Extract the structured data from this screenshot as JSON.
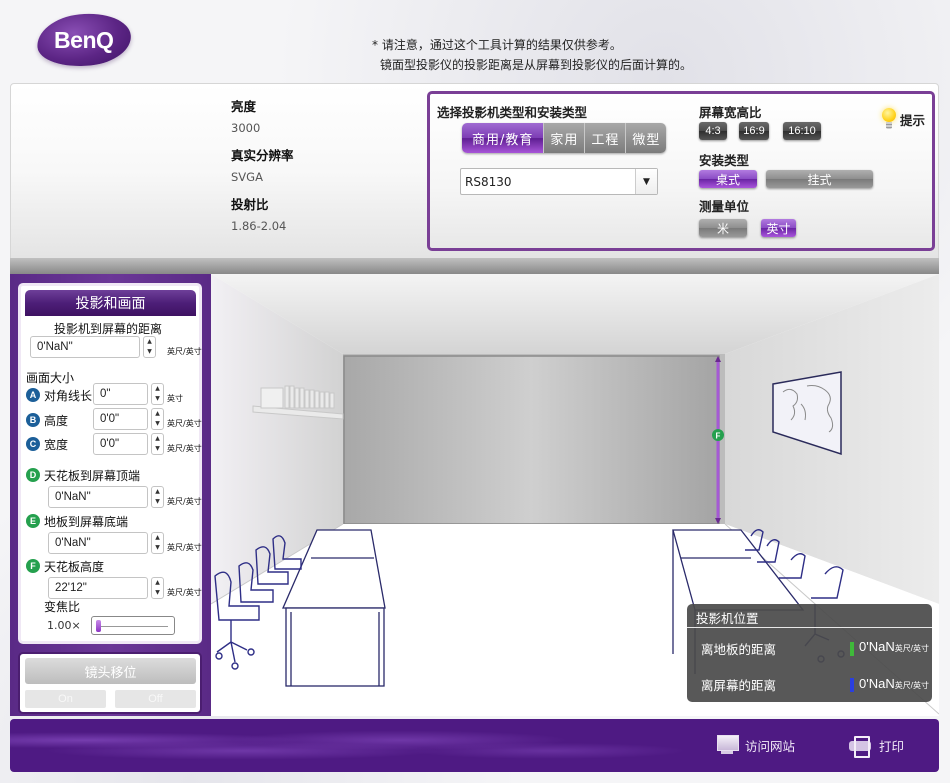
{
  "brand": {
    "logo_text": "BenQ"
  },
  "notice": {
    "line1": "* 请注意，通过这个工具计算的结果仅供参考。",
    "line2": "镜面型投影仪的投影距离是从屏幕到投影仪的后面计算的。"
  },
  "specs": [
    {
      "label": "亮度",
      "value": "3000"
    },
    {
      "label": "真实分辨率",
      "value": "SVGA"
    },
    {
      "label": "投射比",
      "value": "1.86-2.04"
    }
  ],
  "selector": {
    "title": "选择投影机类型和安装类型",
    "type_tabs": [
      {
        "label": "商用/教育",
        "active": true
      },
      {
        "label": "家用",
        "active": false
      },
      {
        "label": "工程",
        "active": false
      },
      {
        "label": "微型",
        "active": false
      }
    ],
    "model": {
      "value": "RS8130",
      "arrow_icon": "caret-down-icon"
    },
    "aspect_label": "屏幕宽高比",
    "aspect_options": [
      "4:3",
      "16:9",
      "16:10"
    ],
    "mount_label": "安装类型",
    "mount_options": [
      {
        "label": "桌式",
        "active": true
      },
      {
        "label": "挂式",
        "active": false
      }
    ],
    "unit_label": "测量单位",
    "unit_options": [
      {
        "label": "米",
        "active": false
      },
      {
        "label": "英寸",
        "active": true
      }
    ],
    "hint_label": "提示"
  },
  "left_panel": {
    "title": "投影和画面",
    "distance_label": "投影机到屏幕的距离",
    "distance_value": "0'NaN\"",
    "unit_ft_in": "英尺/英寸",
    "unit_in": "英寸",
    "screen_size_label": "画面大小",
    "fields": [
      {
        "badge": "A",
        "label": "对角线长",
        "value": "0\"",
        "unit": "英寸"
      },
      {
        "badge": "B",
        "label": "高度",
        "value": "0'0\"",
        "unit": "英尺/英寸"
      },
      {
        "badge": "C",
        "label": "宽度",
        "value": "0'0\"",
        "unit": "英尺/英寸"
      },
      {
        "badge": "D",
        "label": "天花板到屏幕顶端",
        "value": "0'NaN\"",
        "unit": "英尺/英寸"
      },
      {
        "badge": "E",
        "label": "地板到屏幕底端",
        "value": "0'NaN\"",
        "unit": "英尺/英寸"
      },
      {
        "badge": "F",
        "label": "天花板高度",
        "value": "22'12\"",
        "unit": "英尺/英寸"
      }
    ],
    "zoom_label": "变焦比",
    "zoom_value": "1.00×",
    "zoom_fraction": 0.0
  },
  "lens_shift": {
    "title": "镜头移位",
    "on_label": "On",
    "off_label": "Off"
  },
  "scene": {
    "marker_label": "F"
  },
  "projector_position": {
    "title": "投影机位置",
    "rows": [
      {
        "label": "离地板的距离",
        "value": "0'NaN",
        "unit": "英尺/英寸",
        "color": "#3fb93a"
      },
      {
        "label": "离屏幕的距离",
        "value": "0'NaN",
        "unit": "英尺/英寸",
        "color": "#2a3fe0"
      }
    ]
  },
  "footer": {
    "visit_label": "访问网站",
    "print_label": "打印"
  }
}
